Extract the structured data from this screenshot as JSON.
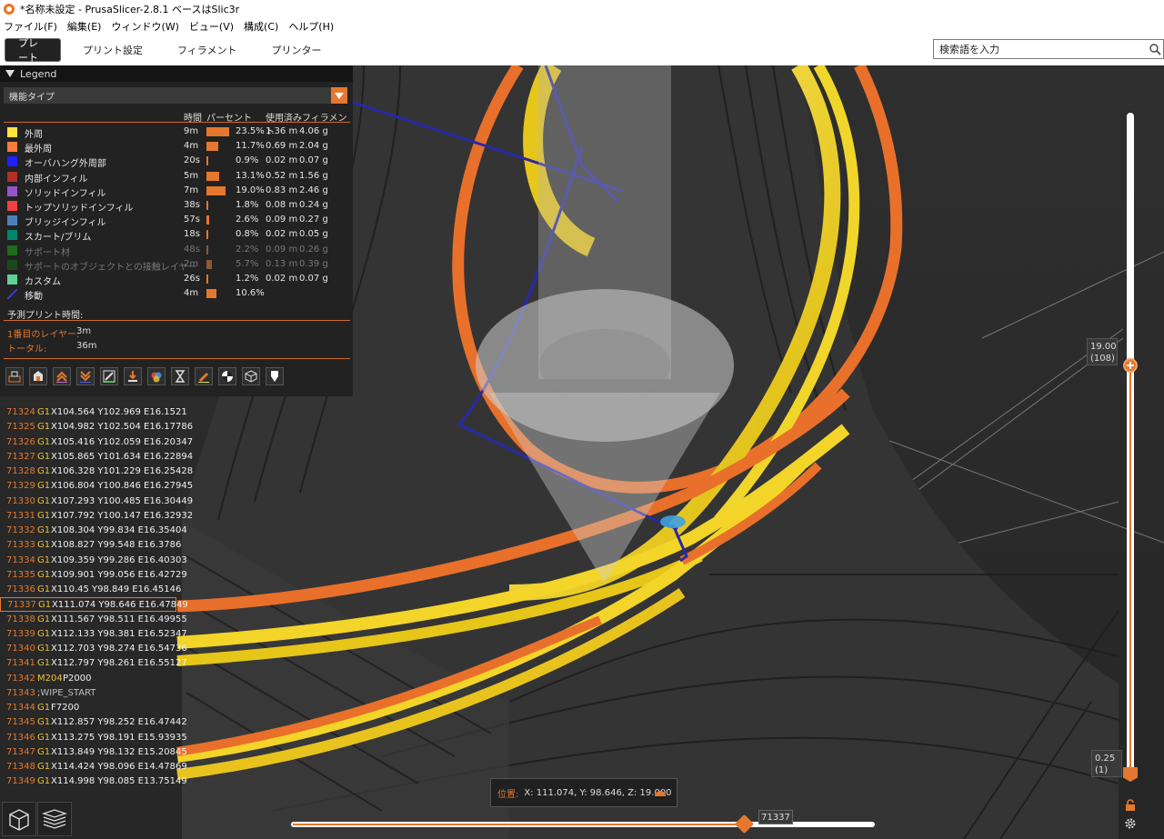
{
  "window": {
    "title": "*名称未設定 - PrusaSlicer-2.8.1 ベースはSlic3r"
  },
  "menu": [
    "ファイル(F)",
    "編集(E)",
    "ウィンドウ(W)",
    "ビュー(V)",
    "構成(C)",
    "ヘルプ(H)"
  ],
  "tabs": [
    "プレート",
    "プリント設定",
    "フィラメント",
    "プリンター"
  ],
  "search": {
    "placeholder": "検索語を入力"
  },
  "legend": {
    "title": "Legend",
    "select_value": "機能タイプ",
    "columns": {
      "time": "時間",
      "percent": "パーセント",
      "used": "使用済みフィラメント"
    },
    "rows": [
      {
        "name": "外周",
        "color": "#ffe53b",
        "time": "9m",
        "percent": "23.5%",
        "fraction": 0.235,
        "length": "1.36 m",
        "weight": "4.06 g",
        "dim": false,
        "travel": false
      },
      {
        "name": "最外周",
        "color": "#ff7d38",
        "time": "4m",
        "percent": "11.7%",
        "fraction": 0.117,
        "length": "0.69 m",
        "weight": "2.04 g",
        "dim": false,
        "travel": false
      },
      {
        "name": "オーバハング外周部",
        "color": "#1f1fff",
        "time": "20s",
        "percent": "0.9%",
        "fraction": 0.009,
        "length": "0.02 m",
        "weight": "0.07 g",
        "dim": false,
        "travel": false
      },
      {
        "name": "内部インフィル",
        "color": "#b03029",
        "time": "5m",
        "percent": "13.1%",
        "fraction": 0.131,
        "length": "0.52 m",
        "weight": "1.56 g",
        "dim": false,
        "travel": false
      },
      {
        "name": "ソリッドインフィル",
        "color": "#9654cc",
        "time": "7m",
        "percent": "19.0%",
        "fraction": 0.19,
        "length": "0.83 m",
        "weight": "2.46 g",
        "dim": false,
        "travel": false
      },
      {
        "name": "トップソリッドインフィル",
        "color": "#f04040",
        "time": "38s",
        "percent": "1.8%",
        "fraction": 0.018,
        "length": "0.08 m",
        "weight": "0.24 g",
        "dim": false,
        "travel": false
      },
      {
        "name": "ブリッジインフィル",
        "color": "#4d80ba",
        "time": "57s",
        "percent": "2.6%",
        "fraction": 0.026,
        "length": "0.09 m",
        "weight": "0.27 g",
        "dim": false,
        "travel": false
      },
      {
        "name": "スカート/ブリム",
        "color": "#00876e",
        "time": "18s",
        "percent": "0.8%",
        "fraction": 0.008,
        "length": "0.02 m",
        "weight": "0.05 g",
        "dim": false,
        "travel": false
      },
      {
        "name": "サポート材",
        "color": "#1e6b1e",
        "time": "48s",
        "percent": "2.2%",
        "fraction": 0.022,
        "length": "0.09 m",
        "weight": "0.26 g",
        "dim": true,
        "travel": false
      },
      {
        "name": "サポートのオブジェクトとの接触レイヤー",
        "color": "#1a4a1a",
        "time": "2m",
        "percent": "5.7%",
        "fraction": 0.057,
        "length": "0.13 m",
        "weight": "0.39 g",
        "dim": true,
        "travel": false
      },
      {
        "name": "カスタム",
        "color": "#5ed194",
        "time": "26s",
        "percent": "1.2%",
        "fraction": 0.012,
        "length": "0.02 m",
        "weight": "0.07 g",
        "dim": false,
        "travel": false
      },
      {
        "name": "移動",
        "color": "#3b3bd0",
        "time": "4m",
        "percent": "10.6%",
        "fraction": 0.106,
        "length": "",
        "weight": "",
        "dim": false,
        "travel": true
      }
    ],
    "estimate_title": "予測プリント時間:",
    "first_layer_label": "1番目のレイヤー:",
    "first_layer_value": "3m",
    "total_label": "トータル:",
    "total_value": "36m"
  },
  "gcode": [
    {
      "n": "71324",
      "cmd": "G1",
      "args": "X104.564 Y102.969 E16.1521"
    },
    {
      "n": "71325",
      "cmd": "G1",
      "args": "X104.982 Y102.504 E16.17786"
    },
    {
      "n": "71326",
      "cmd": "G1",
      "args": "X105.416 Y102.059 E16.20347"
    },
    {
      "n": "71327",
      "cmd": "G1",
      "args": "X105.865 Y101.634 E16.22894"
    },
    {
      "n": "71328",
      "cmd": "G1",
      "args": "X106.328 Y101.229 E16.25428"
    },
    {
      "n": "71329",
      "cmd": "G1",
      "args": "X106.804 Y100.846 E16.27945"
    },
    {
      "n": "71330",
      "cmd": "G1",
      "args": "X107.293 Y100.485 E16.30449"
    },
    {
      "n": "71331",
      "cmd": "G1",
      "args": "X107.792 Y100.147 E16.32932"
    },
    {
      "n": "71332",
      "cmd": "G1",
      "args": "X108.304 Y99.834 E16.35404"
    },
    {
      "n": "71333",
      "cmd": "G1",
      "args": "X108.827 Y99.548 E16.3786"
    },
    {
      "n": "71334",
      "cmd": "G1",
      "args": "X109.359 Y99.286 E16.40303"
    },
    {
      "n": "71335",
      "cmd": "G1",
      "args": "X109.901 Y99.056 E16.42729"
    },
    {
      "n": "71336",
      "cmd": "G1",
      "args": "X110.45 Y98.849 E16.45146"
    },
    {
      "n": "71337",
      "cmd": "G1",
      "args": "X111.074 Y98.646 E16.47849",
      "current": true
    },
    {
      "n": "71338",
      "cmd": "G1",
      "args": "X111.567 Y98.511 E16.49955"
    },
    {
      "n": "71339",
      "cmd": "G1",
      "args": "X112.133 Y98.381 E16.52347"
    },
    {
      "n": "71340",
      "cmd": "G1",
      "args": "X112.703 Y98.274 E16.54736"
    },
    {
      "n": "71341",
      "cmd": "G1",
      "args": "X112.797 Y98.261 E16.55127"
    },
    {
      "n": "71342",
      "cmd": "M204",
      "args": "P2000"
    },
    {
      "n": "71343",
      "cmd": ";WIPE_START",
      "args": "",
      "comment": true
    },
    {
      "n": "71344",
      "cmd": "G1",
      "args": "F7200"
    },
    {
      "n": "71345",
      "cmd": "G1",
      "args": "X112.857 Y98.252 E16.47442"
    },
    {
      "n": "71346",
      "cmd": "G1",
      "args": "X113.275 Y98.191 E15.93935"
    },
    {
      "n": "71347",
      "cmd": "G1",
      "args": "X113.849 Y98.132 E15.20845"
    },
    {
      "n": "71348",
      "cmd": "G1",
      "args": "X114.424 Y98.096 E14.47869"
    },
    {
      "n": "71349",
      "cmd": "G1",
      "args": "X114.998 Y98.085 E13.75149"
    }
  ],
  "position": {
    "label": "位置:",
    "value": "X: 111.074, Y: 98.646, Z: 19.000"
  },
  "horizontal_slider": {
    "label": "71337",
    "fraction": 0.77
  },
  "vertical_slider": {
    "top_value": "19.00",
    "top_layer": "(108)",
    "bottom_value": "0.25",
    "bottom_layer": "(1)"
  },
  "colors": {
    "accent": "#e4782e",
    "perimeter": "#ffe53b",
    "external_perimeter": "#ff7d38",
    "travel": "#3b3bd0"
  },
  "icons": [
    "shells-icon",
    "tool-marker-icon",
    "retractions-icon",
    "deretractions-icon",
    "seams-icon",
    "tool-changes-icon",
    "color-changes-icon",
    "pause-icon",
    "custom-gcode-icon",
    "center-of-gravity-icon",
    "shells-box-icon",
    "tool-position-icon"
  ]
}
